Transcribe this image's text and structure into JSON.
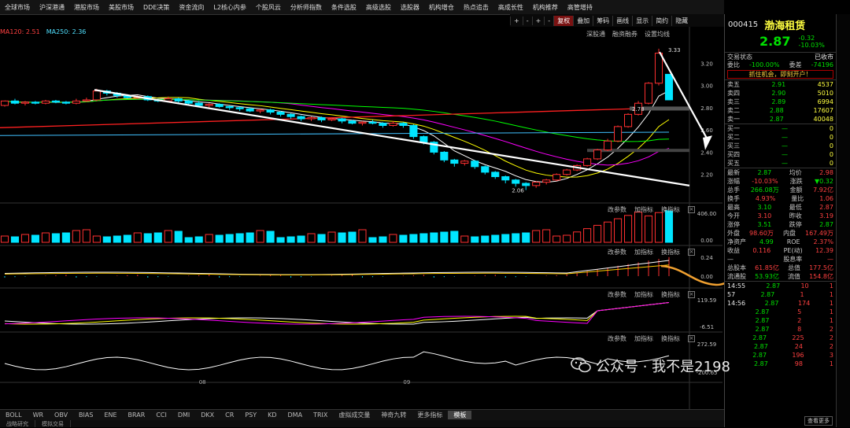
{
  "colors": {
    "up": "#ff3030",
    "down": "#00e5ff",
    "ma5": "#ffffff",
    "ma10": "#ffff00",
    "ma20": "#ff00ff",
    "ma60": "#00ff00",
    "ma120": "#ff2020",
    "ma250": "#40c0ff",
    "trend": "#ffffff"
  },
  "top_menu": [
    "全球市场",
    "沪深港通",
    "港股市场",
    "美股市场",
    "DDE决策",
    "资金流向",
    "L2核心内参",
    "个股风云",
    "分析师指数",
    "条件选股",
    "高级选股",
    "选股器",
    "机构增仓",
    "热点追击",
    "高成长性",
    "机构推荐",
    "高管增持"
  ],
  "toolbar": {
    "nav": [
      "+",
      "-",
      "+",
      "-"
    ],
    "adjust": "复权",
    "overlay": "叠加",
    "items": [
      "筹码",
      "画线",
      "显示",
      "简约",
      "隐藏"
    ]
  },
  "ma_labels": [
    "MA120: 2.51",
    "MA250: 2.36"
  ],
  "sub_tabs": [
    "深股通",
    "融资融券",
    "设置均线"
  ],
  "price_axis": [
    "3.20",
    "3.00",
    "2.80",
    "2.60",
    "2.40",
    "2.20"
  ],
  "annotations": {
    "high": "3.33",
    "low": "2.06",
    "mid": "2.78"
  },
  "panel_tools": {
    "params": "改参数",
    "add": "加指标",
    "switch": "换指标"
  },
  "vol_axis": [
    "406.00",
    "0.00"
  ],
  "macd_axis": [
    "0.24",
    "0.00"
  ],
  "kdj_axis": [
    "119.59",
    "-6.51"
  ],
  "cci_axis": [
    "272.59",
    "-200.65"
  ],
  "x_labels": [
    "08",
    "09"
  ],
  "indicator_tabs": [
    "BOLL",
    "WR",
    "OBV",
    "BIAS",
    "ENE",
    "BRAR",
    "CCI",
    "DMI",
    "DKX",
    "CR",
    "PSY",
    "KD",
    "DMA",
    "TRIX",
    "虚拟成交量",
    "神奇九转",
    "更多指标",
    "模板"
  ],
  "active_indicator": "模板",
  "status_tabs": [
    "战略研究",
    "模拟交易"
  ],
  "stock": {
    "code": "000415",
    "name": "渤海租赁",
    "price": "2.87",
    "change": "-0.32",
    "pct": "-10.03%",
    "status_label": "交易状态",
    "status": "已收市",
    "wb_label": "委比",
    "wb": "-100.00%",
    "wc_label": "委差",
    "wc": "-74196",
    "ad": "抓住机会，即刻开户！"
  },
  "asks": [
    {
      "l": "卖五",
      "p": "2.91",
      "v": "4537"
    },
    {
      "l": "卖四",
      "p": "2.90",
      "v": "5010"
    },
    {
      "l": "卖三",
      "p": "2.89",
      "v": "6994"
    },
    {
      "l": "卖二",
      "p": "2.88",
      "v": "17607"
    },
    {
      "l": "卖一",
      "p": "2.87",
      "v": "40048"
    }
  ],
  "bids": [
    {
      "l": "买一",
      "p": "—",
      "v": "0"
    },
    {
      "l": "买二",
      "p": "—",
      "v": "0"
    },
    {
      "l": "买三",
      "p": "—",
      "v": "0"
    },
    {
      "l": "买四",
      "p": "—",
      "v": "0"
    },
    {
      "l": "买五",
      "p": "—",
      "v": "0"
    }
  ],
  "stats": [
    [
      "最新",
      "2.87",
      "均价",
      "2.98"
    ],
    [
      "涨幅",
      "-10.03%",
      "涨跌",
      "▼0.32"
    ],
    [
      "总手",
      "266.08万",
      "金额",
      "7.92亿"
    ],
    [
      "换手",
      "4.93%",
      "量比",
      "1.06"
    ],
    [
      "最高",
      "3.10",
      "最低",
      "2.87"
    ],
    [
      "今开",
      "3.10",
      "昨收",
      "3.19"
    ],
    [
      "涨停",
      "3.51",
      "跌停",
      "2.87"
    ],
    [
      "外盘",
      "98.60万",
      "内盘",
      "167.49万"
    ],
    [
      "净资产",
      "4.99",
      "ROE",
      "2.37%"
    ],
    [
      "收益",
      "0.116",
      "PE(动)",
      "12.39"
    ],
    [
      "—",
      "",
      "股息率",
      "—"
    ],
    [
      "总股本",
      "61.85亿",
      "总值",
      "177.5亿"
    ],
    [
      "流通股",
      "53.93亿",
      "流值",
      "154.8亿"
    ]
  ],
  "ticks": [
    [
      "14:55",
      "2.87",
      "10",
      "1"
    ],
    [
      "57",
      "2.87",
      "1",
      "1"
    ],
    [
      "14:56",
      "2.87",
      "174",
      "1"
    ],
    [
      "",
      "2.87",
      "5",
      "1"
    ],
    [
      "",
      "2.87",
      "2",
      "1"
    ],
    [
      "",
      "2.87",
      "8",
      "2"
    ],
    [
      "",
      "2.87",
      "225",
      "2"
    ],
    [
      "",
      "2.87",
      "24",
      "2"
    ],
    [
      "",
      "2.87",
      "196",
      "3"
    ],
    [
      "",
      "2.87",
      "98",
      "1"
    ]
  ],
  "view_more": "查看更多",
  "watermark": "公众号 · 我不是2198",
  "chart_data": {
    "type": "candlestick",
    "candles": [
      [
        2.82,
        2.86,
        2.84,
        2.81
      ],
      [
        2.86,
        2.84,
        2.88,
        2.83
      ],
      [
        2.84,
        2.85,
        2.86,
        2.82
      ],
      [
        2.85,
        2.84,
        2.86,
        2.83
      ],
      [
        2.84,
        2.86,
        2.87,
        2.83
      ],
      [
        2.86,
        2.85,
        2.87,
        2.84
      ],
      [
        2.85,
        2.84,
        2.86,
        2.83
      ],
      [
        2.84,
        2.86,
        2.88,
        2.83
      ],
      [
        2.86,
        2.87,
        2.89,
        2.85
      ],
      [
        2.87,
        2.95,
        2.97,
        2.86
      ],
      [
        2.95,
        2.93,
        2.96,
        2.91
      ],
      [
        2.93,
        2.91,
        2.94,
        2.89
      ],
      [
        2.91,
        2.89,
        2.92,
        2.88
      ],
      [
        2.89,
        2.9,
        2.91,
        2.88
      ],
      [
        2.9,
        2.87,
        2.91,
        2.86
      ],
      [
        2.87,
        2.86,
        2.88,
        2.85
      ],
      [
        2.86,
        2.88,
        2.9,
        2.85
      ],
      [
        2.88,
        2.86,
        2.89,
        2.84
      ],
      [
        2.86,
        2.84,
        2.87,
        2.82
      ],
      [
        2.84,
        2.82,
        2.86,
        2.81
      ],
      [
        2.82,
        2.83,
        2.84,
        2.8
      ],
      [
        2.83,
        2.81,
        2.84,
        2.8
      ],
      [
        2.81,
        2.8,
        2.82,
        2.78
      ],
      [
        2.8,
        2.79,
        2.81,
        2.77
      ],
      [
        2.79,
        2.77,
        2.8,
        2.76
      ],
      [
        2.77,
        2.78,
        2.79,
        2.75
      ],
      [
        2.78,
        2.76,
        2.79,
        2.74
      ],
      [
        2.76,
        2.74,
        2.77,
        2.72
      ],
      [
        2.74,
        2.72,
        2.75,
        2.7
      ],
      [
        2.72,
        2.7,
        2.73,
        2.68
      ],
      [
        2.7,
        2.71,
        2.72,
        2.68
      ],
      [
        2.71,
        2.69,
        2.72,
        2.67
      ],
      [
        2.69,
        2.7,
        2.71,
        2.68
      ],
      [
        2.7,
        2.68,
        2.71,
        2.66
      ],
      [
        2.68,
        2.66,
        2.69,
        2.65
      ],
      [
        2.66,
        2.67,
        2.68,
        2.64
      ],
      [
        2.67,
        2.66,
        2.69,
        2.65
      ],
      [
        2.66,
        2.64,
        2.67,
        2.62
      ],
      [
        2.64,
        2.66,
        2.68,
        2.63
      ],
      [
        2.66,
        2.64,
        2.67,
        2.62
      ],
      [
        2.64,
        2.54,
        2.65,
        2.52
      ],
      [
        2.54,
        2.49,
        2.55,
        2.47
      ],
      [
        2.49,
        2.4,
        2.5,
        2.38
      ],
      [
        2.4,
        2.33,
        2.41,
        2.31
      ],
      [
        2.33,
        2.3,
        2.34,
        2.27
      ],
      [
        2.3,
        2.32,
        2.33,
        2.28
      ],
      [
        2.32,
        2.27,
        2.33,
        2.25
      ],
      [
        2.27,
        2.22,
        2.28,
        2.2
      ],
      [
        2.22,
        2.18,
        2.23,
        2.16
      ],
      [
        2.18,
        2.15,
        2.19,
        2.12
      ],
      [
        2.15,
        2.12,
        2.16,
        2.09
      ],
      [
        2.12,
        2.1,
        2.13,
        2.06
      ],
      [
        2.1,
        2.13,
        2.14,
        2.08
      ],
      [
        2.13,
        2.15,
        2.16,
        2.11
      ],
      [
        2.15,
        2.2,
        2.21,
        2.14
      ],
      [
        2.2,
        2.24,
        2.25,
        2.19
      ],
      [
        2.24,
        2.28,
        2.29,
        2.23
      ],
      [
        2.28,
        2.34,
        2.35,
        2.27
      ],
      [
        2.34,
        2.42,
        2.43,
        2.33
      ],
      [
        2.42,
        2.5,
        2.52,
        2.41
      ],
      [
        2.5,
        2.63,
        2.64,
        2.49
      ],
      [
        2.63,
        2.74,
        2.75,
        2.62
      ],
      [
        2.74,
        2.84,
        2.86,
        2.73
      ],
      [
        2.84,
        3.02,
        3.03,
        2.83
      ],
      [
        3.02,
        3.29,
        3.33,
        3.0
      ],
      [
        3.1,
        2.87,
        3.1,
        2.87
      ]
    ]
  }
}
